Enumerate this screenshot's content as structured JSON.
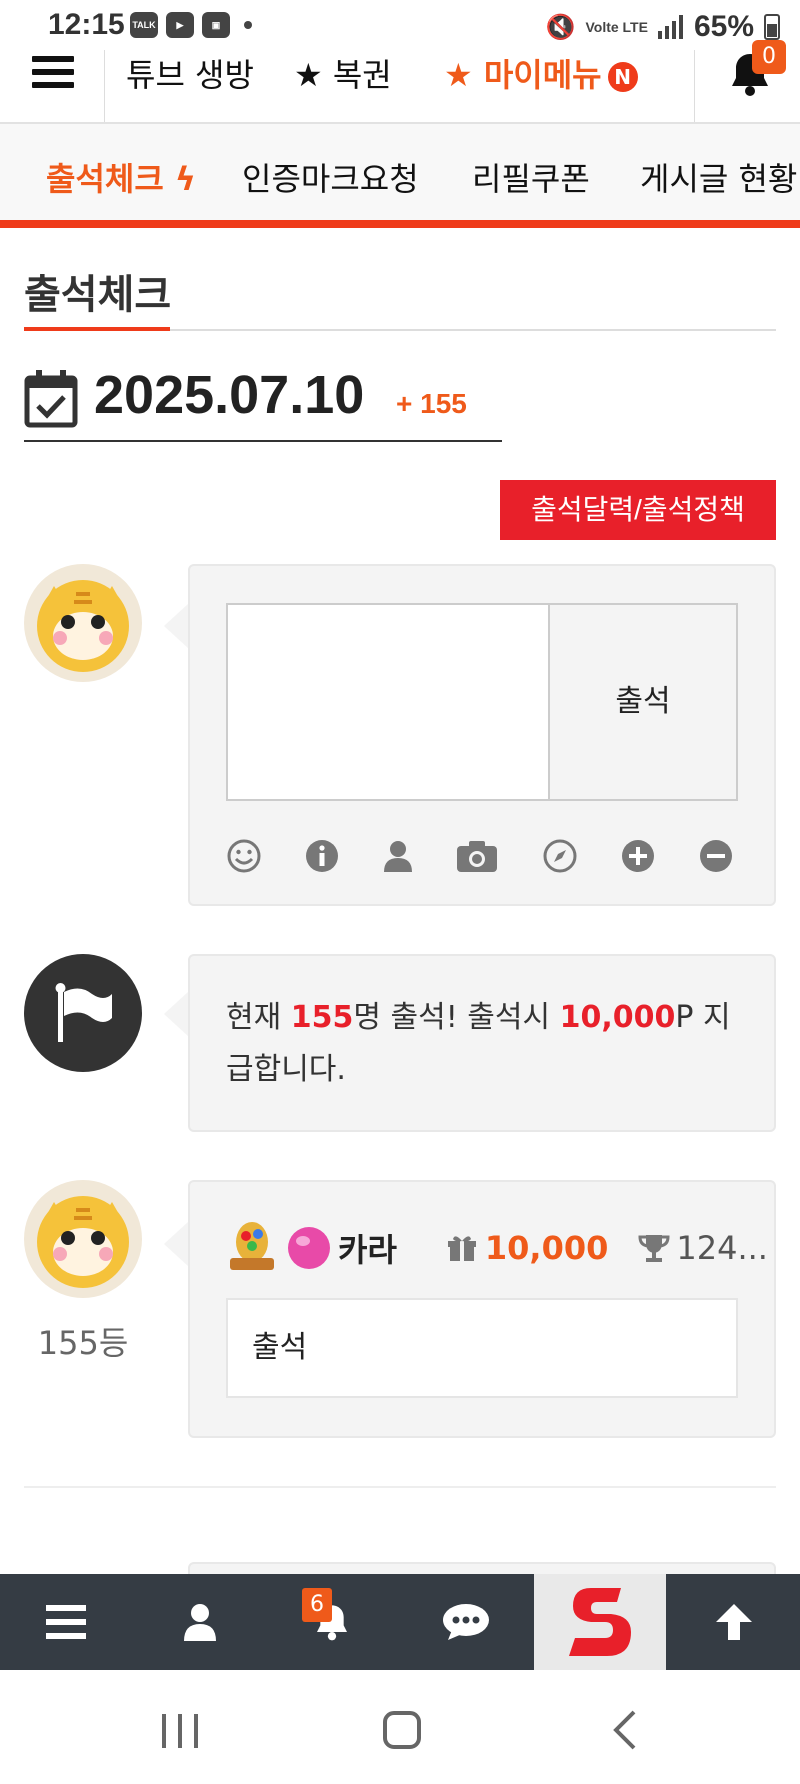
{
  "status_bar": {
    "time": "12:15",
    "notif_talk": "TALK",
    "network": "Volte LTE",
    "battery": "65%"
  },
  "top_nav": {
    "items": [
      "튜브 생방",
      "★ 복권",
      "★ 마이메뉴"
    ],
    "my_menu_badge": "N",
    "bell_badge": "0"
  },
  "sub_nav": {
    "items": [
      "출석체크",
      "인증마크요청",
      "리필쿠폰",
      "게시글 현황"
    ]
  },
  "page": {
    "section_title": "출석체크",
    "date": "2025.07.10",
    "date_count": "+ 155",
    "policy_button": "출석달력/출석정책"
  },
  "composer": {
    "submit_label": "출석",
    "tools": [
      "smile-icon",
      "info-icon",
      "user-icon",
      "camera-icon",
      "compass-icon",
      "plus-circle-icon",
      "minus-circle-icon"
    ]
  },
  "notice": {
    "prefix": "현재 ",
    "count": "155",
    "mid": "명 출석! 출석시 ",
    "points": "10,000",
    "suffix": "P 지급합니다."
  },
  "entries": [
    {
      "rank": "155등",
      "nickname": "카라",
      "points": "10,000",
      "trophy": "124...",
      "message": "출석"
    }
  ],
  "bottom_bar": {
    "notif_badge": "6"
  },
  "colors": {
    "accent": "#ef5a1a",
    "red": "#e8202a",
    "bottom_bar": "#353c44"
  }
}
